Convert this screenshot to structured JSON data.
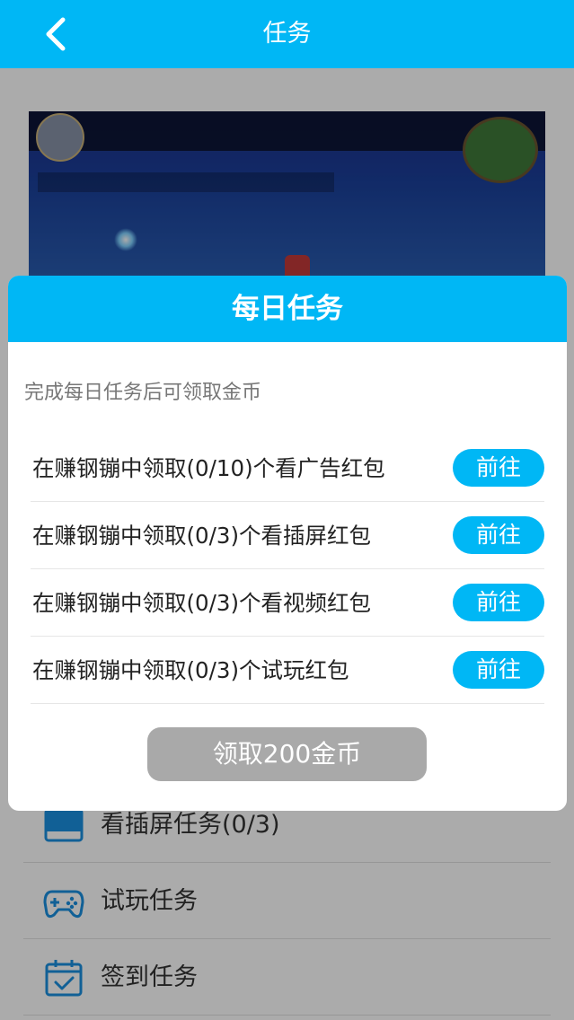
{
  "navbar": {
    "title": "任务"
  },
  "colors": {
    "accent": "#00b7f5",
    "disabled_button": "#a9a9a9"
  },
  "task_list": [
    {
      "label": "看插屏任务(0/3)",
      "icon": "screen-icon"
    },
    {
      "label": "试玩任务",
      "icon": "gamepad-icon"
    },
    {
      "label": "签到任务",
      "icon": "calendar-check-icon"
    }
  ],
  "dialog": {
    "title": "每日任务",
    "subtitle": "完成每日任务后可领取金币",
    "tasks": [
      {
        "text": "在赚钢镚中领取(0/10)个看广告红包",
        "button": "前往"
      },
      {
        "text": "在赚钢镚中领取(0/3)个看插屏红包",
        "button": "前往"
      },
      {
        "text": "在赚钢镚中领取(0/3)个看视频红包",
        "button": "前往"
      },
      {
        "text": "在赚钢镚中领取(0/3)个试玩红包",
        "button": "前往"
      }
    ],
    "claim_button": "领取200金币"
  }
}
